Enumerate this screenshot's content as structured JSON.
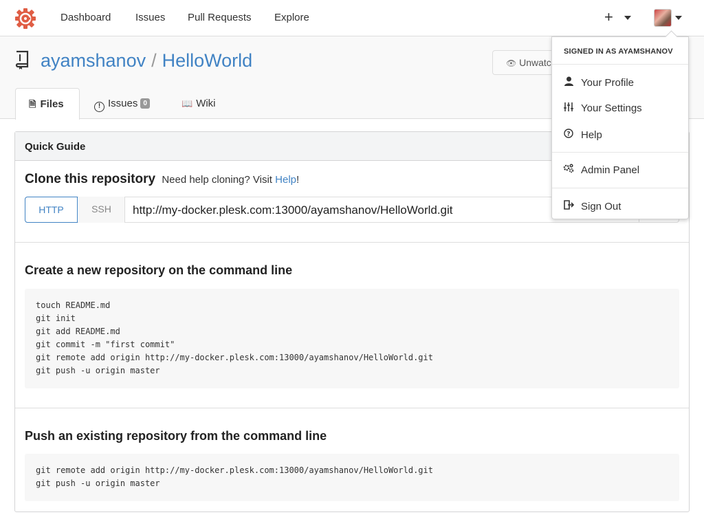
{
  "colors": {
    "accent": "#4183c4",
    "logo": "#e05d44"
  },
  "topnav": {
    "items": [
      "Dashboard",
      "Issues",
      "Pull Requests",
      "Explore"
    ],
    "plus": "+"
  },
  "repo": {
    "owner": "ayamshanov",
    "separator": "/",
    "name": "HelloWorld",
    "watch_label": "Unwatch",
    "tabs": [
      {
        "label": "Files",
        "icon": "file-text-icon"
      },
      {
        "label": "Issues",
        "icon": "issue-icon",
        "badge": "0"
      },
      {
        "label": "Wiki",
        "icon": "book-open-icon"
      }
    ]
  },
  "guide": {
    "title": "Quick Guide",
    "clone": {
      "heading": "Clone this repository",
      "help_prefix": "Need help cloning? Visit",
      "help_link": "Help",
      "help_suffix": "!",
      "http_label": "HTTP",
      "ssh_label": "SSH",
      "url": "http://my-docker.plesk.com:13000/ayamshanov/HelloWorld.git"
    },
    "create": {
      "heading": "Create a new repository on the command line",
      "code": "touch README.md\ngit init\ngit add README.md\ngit commit -m \"first commit\"\ngit remote add origin http://my-docker.plesk.com:13000/ayamshanov/HelloWorld.git\ngit push -u origin master"
    },
    "push": {
      "heading": "Push an existing repository from the command line",
      "code": "git remote add origin http://my-docker.plesk.com:13000/ayamshanov/HelloWorld.git\ngit push -u origin master"
    }
  },
  "user_menu": {
    "header": "SIGNED IN AS AYAMSHANOV",
    "items": [
      {
        "label": "Your Profile",
        "icon": "person-icon"
      },
      {
        "label": "Your Settings",
        "icon": "settings-sliders-icon"
      },
      {
        "label": "Help",
        "icon": "question-icon"
      },
      {
        "label": "Admin Panel",
        "icon": "gears-icon"
      },
      {
        "label": "Sign Out",
        "icon": "sign-out-icon"
      }
    ]
  }
}
